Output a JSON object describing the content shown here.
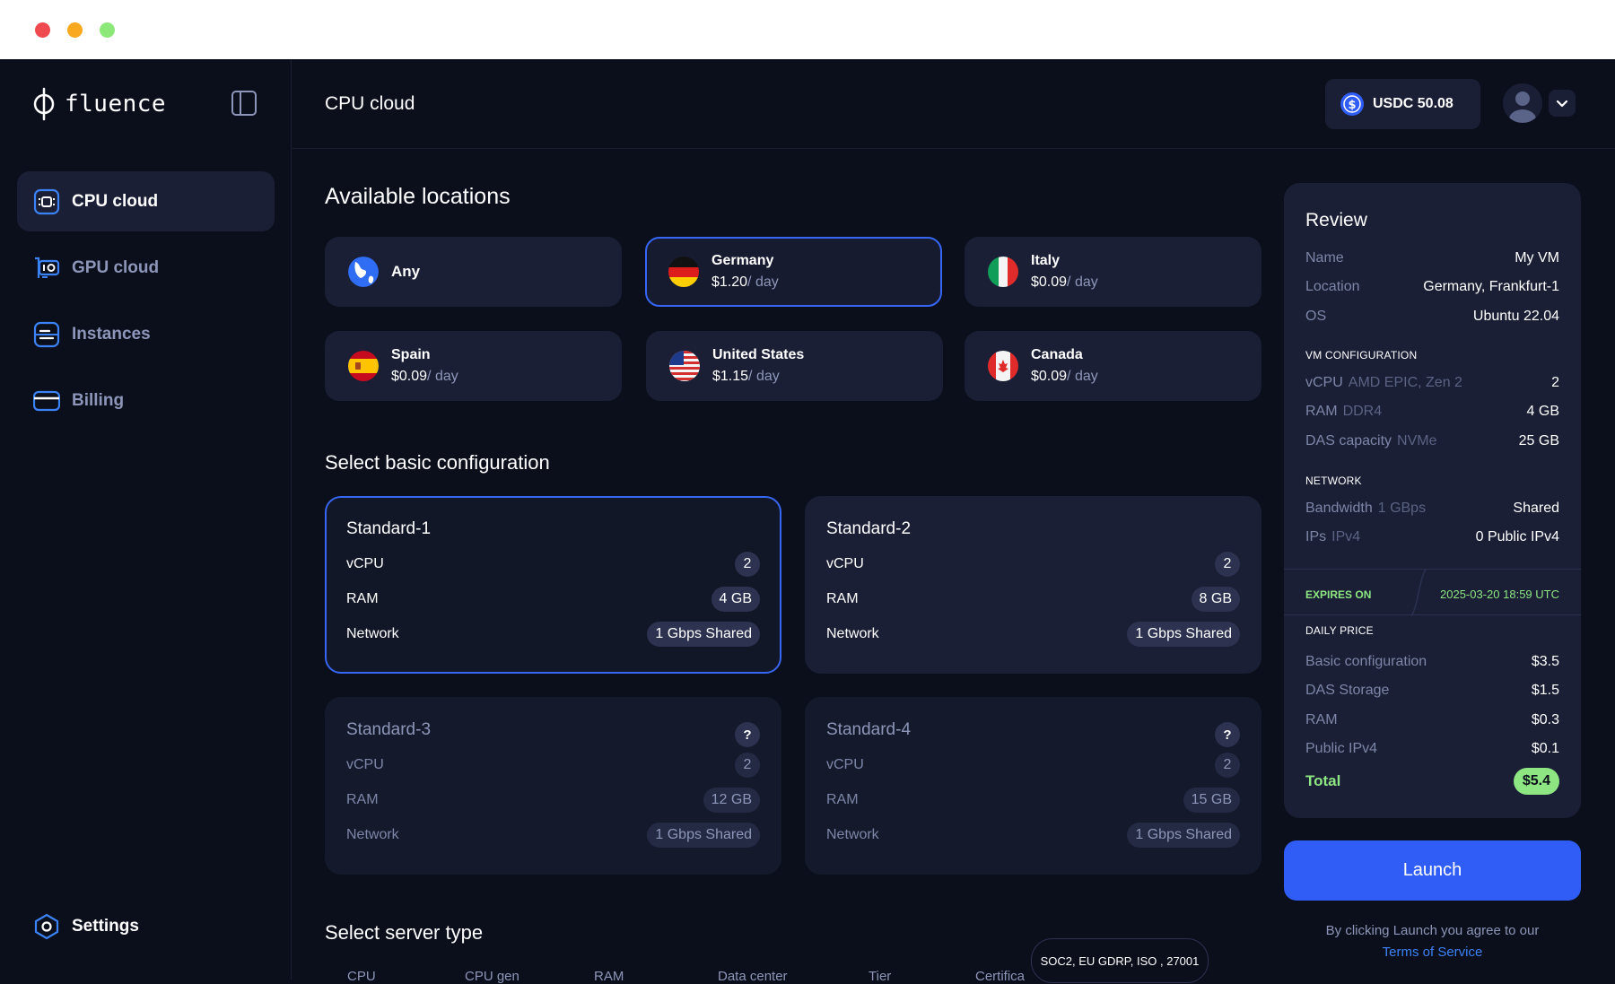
{
  "window": {
    "title_bar_colors": {
      "close": "#ee4a4f",
      "minimize": "#f8a91f",
      "maximize": "#8de87a"
    }
  },
  "brand": {
    "name": "fluence"
  },
  "sidebar": {
    "items": [
      {
        "label": "CPU cloud",
        "icon": "cpu-icon",
        "active": true
      },
      {
        "label": "GPU cloud",
        "icon": "gpu-icon",
        "active": false
      },
      {
        "label": "Instances",
        "icon": "instances-icon",
        "active": false
      },
      {
        "label": "Billing",
        "icon": "card-icon",
        "active": false
      }
    ],
    "settings_label": "Settings"
  },
  "header": {
    "title": "CPU cloud",
    "balance": "USDC 50.08"
  },
  "locations": {
    "title": "Available locations",
    "items": [
      {
        "name": "Any",
        "price": "",
        "unit": ""
      },
      {
        "name": "Germany",
        "price": "$1.20",
        "unit": "/ day",
        "selected": true
      },
      {
        "name": "Italy",
        "price": "$0.09",
        "unit": "/ day"
      },
      {
        "name": "Spain",
        "price": "$0.09",
        "unit": "/ day"
      },
      {
        "name": "United States",
        "price": "$1.15",
        "unit": "/ day"
      },
      {
        "name": "Canada",
        "price": "$0.09",
        "unit": "/ day"
      }
    ]
  },
  "configuration": {
    "title": "Select basic configuration",
    "labels": {
      "vcpu": "vCPU",
      "ram": "RAM",
      "network": "Network"
    },
    "cards": [
      {
        "name": "Standard-1",
        "vcpu": "2",
        "ram": "4 GB",
        "network": "1 Gbps Shared",
        "selected": true
      },
      {
        "name": "Standard-2",
        "vcpu": "2",
        "ram": "8 GB",
        "network": "1 Gbps Shared"
      },
      {
        "name": "Standard-3",
        "vcpu": "2",
        "ram": "12 GB",
        "network": "1 Gbps Shared",
        "disabled": true,
        "badge": "?"
      },
      {
        "name": "Standard-4",
        "vcpu": "2",
        "ram": "15 GB",
        "network": "1 Gbps Shared",
        "disabled": true,
        "badge": "?"
      }
    ]
  },
  "server_type": {
    "title": "Select server type",
    "columns": [
      "CPU",
      "CPU gen",
      "RAM",
      "Data center",
      "Tier",
      "Certifica"
    ],
    "tooltip": "SOC2, EU GDRP,  ISO , 27001"
  },
  "review": {
    "title": "Review",
    "name_label": "Name",
    "name_value": "My VM",
    "location_label": "Location",
    "location_value": "Germany, Frankfurt-1",
    "os_label": "OS",
    "os_value": "Ubuntu 22.04",
    "vm_group": "VM CONFIGURATION",
    "vcpu_label": "vCPU",
    "vcpu_sub": "AMD EPIC, Zen 2",
    "vcpu_value": "2",
    "ram_label": "RAM",
    "ram_sub": "DDR4",
    "ram_value": "4 GB",
    "das_label": "DAS capacity",
    "das_sub": "NVMe",
    "das_value": "25 GB",
    "network_group": "NETWORK",
    "bandwidth_label": "Bandwidth",
    "bandwidth_sub": "1 GBps",
    "bandwidth_value": "Shared",
    "ips_label": "IPs",
    "ips_sub": "IPv4",
    "ips_value": "0 Public IPv4",
    "expires_label": "EXPIRES ON",
    "expires_value": "2025-03-20 18:59 UTC",
    "price_group": "DAILY PRICE",
    "basic_label": "Basic configuration",
    "basic_value": "$3.5",
    "das_storage_label": "DAS Storage",
    "das_storage_value": "$1.5",
    "ram_price_label": "RAM",
    "ram_price_value": "$0.3",
    "ipv4_label": "Public IPv4",
    "ipv4_value": "$0.1",
    "total_label": "Total",
    "total_value": "$5.4"
  },
  "launch": {
    "label": "Launch",
    "terms_text": "By clicking Launch you agree to our",
    "terms_link": "Terms of Service"
  },
  "colors": {
    "accent": "#2f5df5",
    "success": "#8ee682",
    "surface": "#1a1f35",
    "background": "#0b0f1c"
  }
}
